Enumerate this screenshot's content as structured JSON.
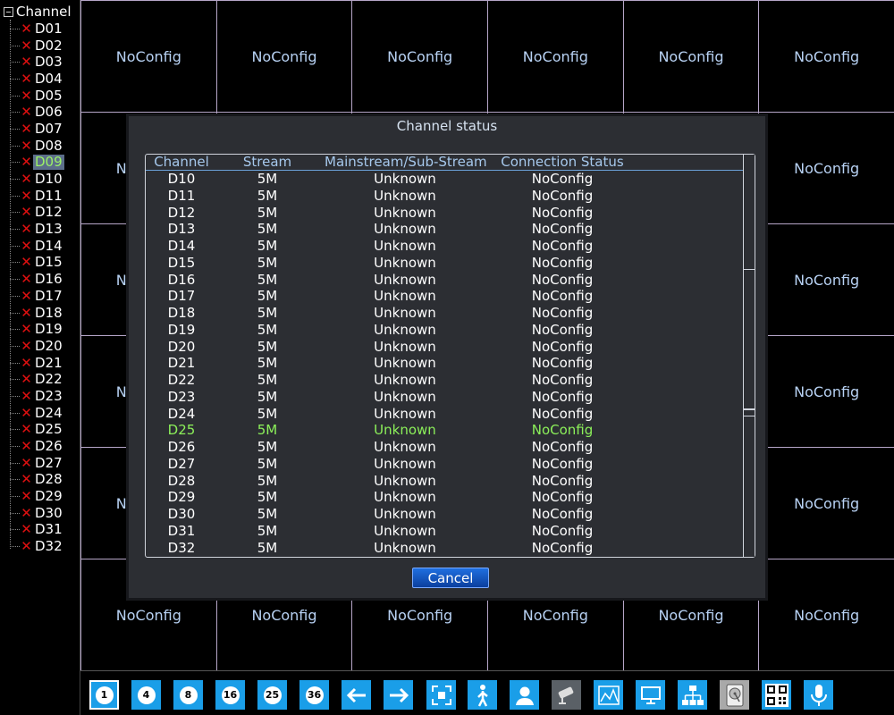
{
  "sidebar": {
    "title": "Channel",
    "selected": "D09",
    "channels": [
      "D01",
      "D02",
      "D03",
      "D04",
      "D05",
      "D06",
      "D07",
      "D08",
      "D09",
      "D10",
      "D11",
      "D12",
      "D13",
      "D14",
      "D15",
      "D16",
      "D17",
      "D18",
      "D19",
      "D20",
      "D21",
      "D22",
      "D23",
      "D24",
      "D25",
      "D26",
      "D27",
      "D28",
      "D29",
      "D30",
      "D31",
      "D32"
    ]
  },
  "grid": {
    "cells": [
      "NoConfig",
      "NoConfig",
      "NoConfig",
      "NoConfig",
      "NoConfig",
      "NoConfig",
      "NoConfig",
      "NoConfig",
      "NoConfig",
      "NoConfig",
      "NoConfig",
      "NoConfig",
      "NoConfig",
      "NoConfig",
      "NoConfig",
      "NoConfig",
      "NoConfig",
      "NoConfig",
      "NoConfig",
      "NoConfig",
      "NoConfig",
      "NoConfig",
      "NoConfig",
      "NoConfig",
      "NoConfig",
      "NoConfig",
      "NoConfig",
      "NoConfig",
      "NoConfig",
      "NoConfig",
      "NoConfig",
      "NoConfig",
      "NoConfig",
      "NoConfig",
      "NoConfig",
      "NoConfig"
    ]
  },
  "dialog": {
    "title": "Channel status",
    "columns": [
      "Channel",
      "Stream",
      "Mainstream/Sub-Stream",
      "Connection Status"
    ],
    "highlight_row": "D25",
    "rows": [
      [
        "D10",
        "5M",
        "Unknown",
        "NoConfig"
      ],
      [
        "D11",
        "5M",
        "Unknown",
        "NoConfig"
      ],
      [
        "D12",
        "5M",
        "Unknown",
        "NoConfig"
      ],
      [
        "D13",
        "5M",
        "Unknown",
        "NoConfig"
      ],
      [
        "D14",
        "5M",
        "Unknown",
        "NoConfig"
      ],
      [
        "D15",
        "5M",
        "Unknown",
        "NoConfig"
      ],
      [
        "D16",
        "5M",
        "Unknown",
        "NoConfig"
      ],
      [
        "D17",
        "5M",
        "Unknown",
        "NoConfig"
      ],
      [
        "D18",
        "5M",
        "Unknown",
        "NoConfig"
      ],
      [
        "D19",
        "5M",
        "Unknown",
        "NoConfig"
      ],
      [
        "D20",
        "5M",
        "Unknown",
        "NoConfig"
      ],
      [
        "D21",
        "5M",
        "Unknown",
        "NoConfig"
      ],
      [
        "D22",
        "5M",
        "Unknown",
        "NoConfig"
      ],
      [
        "D23",
        "5M",
        "Unknown",
        "NoConfig"
      ],
      [
        "D24",
        "5M",
        "Unknown",
        "NoConfig"
      ],
      [
        "D25",
        "5M",
        "Unknown",
        "NoConfig"
      ],
      [
        "D26",
        "5M",
        "Unknown",
        "NoConfig"
      ],
      [
        "D27",
        "5M",
        "Unknown",
        "NoConfig"
      ],
      [
        "D28",
        "5M",
        "Unknown",
        "NoConfig"
      ],
      [
        "D29",
        "5M",
        "Unknown",
        "NoConfig"
      ],
      [
        "D30",
        "5M",
        "Unknown",
        "NoConfig"
      ],
      [
        "D31",
        "5M",
        "Unknown",
        "NoConfig"
      ],
      [
        "D32",
        "5M",
        "Unknown",
        "NoConfig"
      ]
    ],
    "cancel_label": "Cancel"
  },
  "toolbar": {
    "items": [
      {
        "name": "split-1-button",
        "label": "1",
        "kind": "pill",
        "selected": true
      },
      {
        "name": "split-4-button",
        "label": "4",
        "kind": "pill"
      },
      {
        "name": "split-8-button",
        "label": "8",
        "kind": "pill"
      },
      {
        "name": "split-16-button",
        "label": "16",
        "kind": "pill"
      },
      {
        "name": "split-25-button",
        "label": "25",
        "kind": "pill"
      },
      {
        "name": "split-36-button",
        "label": "36",
        "kind": "pill"
      },
      {
        "name": "previous-arrow-icon",
        "kind": "icon"
      },
      {
        "name": "next-arrow-icon",
        "kind": "icon"
      },
      {
        "name": "fullscreen-icon",
        "kind": "icon"
      },
      {
        "name": "person-walking-icon",
        "kind": "icon"
      },
      {
        "name": "user-icon",
        "kind": "icon"
      },
      {
        "name": "ptz-camera-icon",
        "kind": "icon",
        "style": "dim"
      },
      {
        "name": "chart-icon",
        "kind": "icon"
      },
      {
        "name": "monitor-icon",
        "kind": "icon"
      },
      {
        "name": "network-icon",
        "kind": "icon"
      },
      {
        "name": "hard-disk-icon",
        "kind": "icon",
        "style": "hd"
      },
      {
        "name": "qr-code-icon",
        "kind": "icon"
      },
      {
        "name": "microphone-icon",
        "kind": "icon"
      }
    ]
  },
  "colors": {
    "accent": "#1a9ee8",
    "highlight_text": "#8cf05a",
    "error_x": "#e01010",
    "grid_border": "#b6a6c8"
  }
}
